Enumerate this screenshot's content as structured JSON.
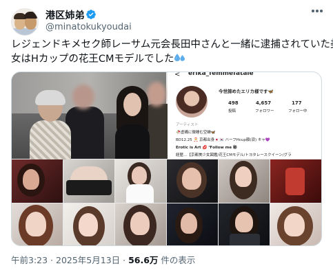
{
  "author": {
    "display_name": "港区姉弟",
    "handle": "@minatokukyoudai",
    "verified": true
  },
  "tweet": {
    "text_line1": "レジェンドキメセク師レーサム元会長田中さんと一緒に逮捕されていた美",
    "text_line2": "女はHカップの花王CMモデルでした",
    "emoji": "sweat-droplets-icon"
  },
  "media": {
    "instagram_panel": {
      "username": "erika_femmefatale",
      "bio_top": "今世諦めたエリカ様です🦋",
      "stats": [
        {
          "value": "498",
          "label": "投稿"
        },
        {
          "value": "4,657",
          "label": "フォロワー"
        },
        {
          "value": "177",
          "label": "フォロー中"
        }
      ],
      "category": "アーティスト",
      "lines": [
        "🥀虚構に微睡む空蝉🦋",
        "BD12.25 🎅 京都出身🇯🇵🇰🇷 ハーフHcup顔(涙) キャ💜",
        "Erotic is Art 💋  ℉ollow me ㊙",
        "経歴…【京都美少女図鑑/花王CMモデル/トヨタレースクイーン/グラ"
      ]
    }
  },
  "footer": {
    "time": "午前3:23",
    "separator": " · ",
    "date": "2025年5月13日",
    "views_count": "56.6万",
    "views_label": " 件の表示"
  },
  "colors": {
    "text_primary": "#0f1419",
    "text_secondary": "#536471",
    "verified_blue": "#1d9bf0",
    "border": "#cfd9de"
  }
}
